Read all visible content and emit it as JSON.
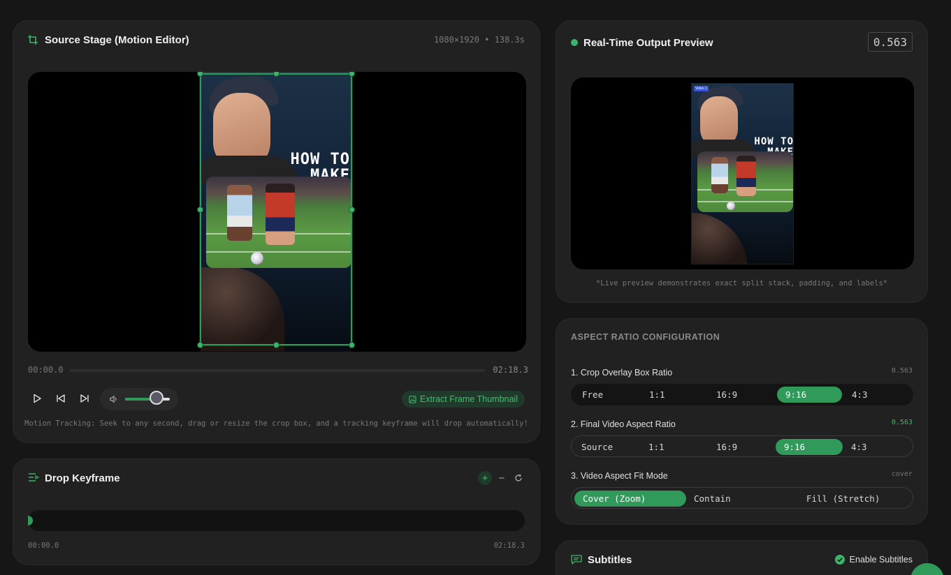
{
  "source": {
    "title": "Source Stage (Motion Editor)",
    "meta": "1080×1920 • 138.3s",
    "overlay_text": "HOW TO MAKE THIS...",
    "time_start": "00:00.0",
    "time_end": "02:18.3",
    "volume_level": 0.7,
    "extract_label": "Extract Frame Thumbnail",
    "hint": "Motion Tracking: Seek to any second, drag or resize the crop box, and a tracking keyframe will drop automatically!"
  },
  "keyframes": {
    "title": "Drop Keyframe",
    "time_start": "00:00.0",
    "time_end": "02:18.3"
  },
  "preview": {
    "title": "Real-Time Output Preview",
    "ratio": "0.563",
    "overlay_text": "HOW TO MAKE THIS...",
    "tag": "Video 1",
    "caption": "*Live preview demonstrates exact split stack, padding, and labels*"
  },
  "aspect": {
    "title": "ASPECT RATIO CONFIGURATION",
    "crop": {
      "label": "1. Crop Overlay Box Ratio",
      "value": "0.563",
      "options": [
        "Free",
        "1:1",
        "16:9",
        "9:16",
        "4:3"
      ],
      "selected": "9:16"
    },
    "final": {
      "label": "2. Final Video Aspect Ratio",
      "value": "0.563",
      "options": [
        "Source",
        "1:1",
        "16:9",
        "9:16",
        "4:3"
      ],
      "selected": "9:16"
    },
    "fit": {
      "label": "3. Video Aspect Fit Mode",
      "value": "cover",
      "options": [
        "Cover (Zoom)",
        "Contain",
        "Fill (Stretch)"
      ],
      "selected": "Cover (Zoom)"
    }
  },
  "subtitles": {
    "title": "Subtitles",
    "toggle_label": "Enable Subtitles",
    "enabled": true
  },
  "colors": {
    "accent": "#2f9a5a",
    "background": "#161616",
    "card": "#212121"
  }
}
